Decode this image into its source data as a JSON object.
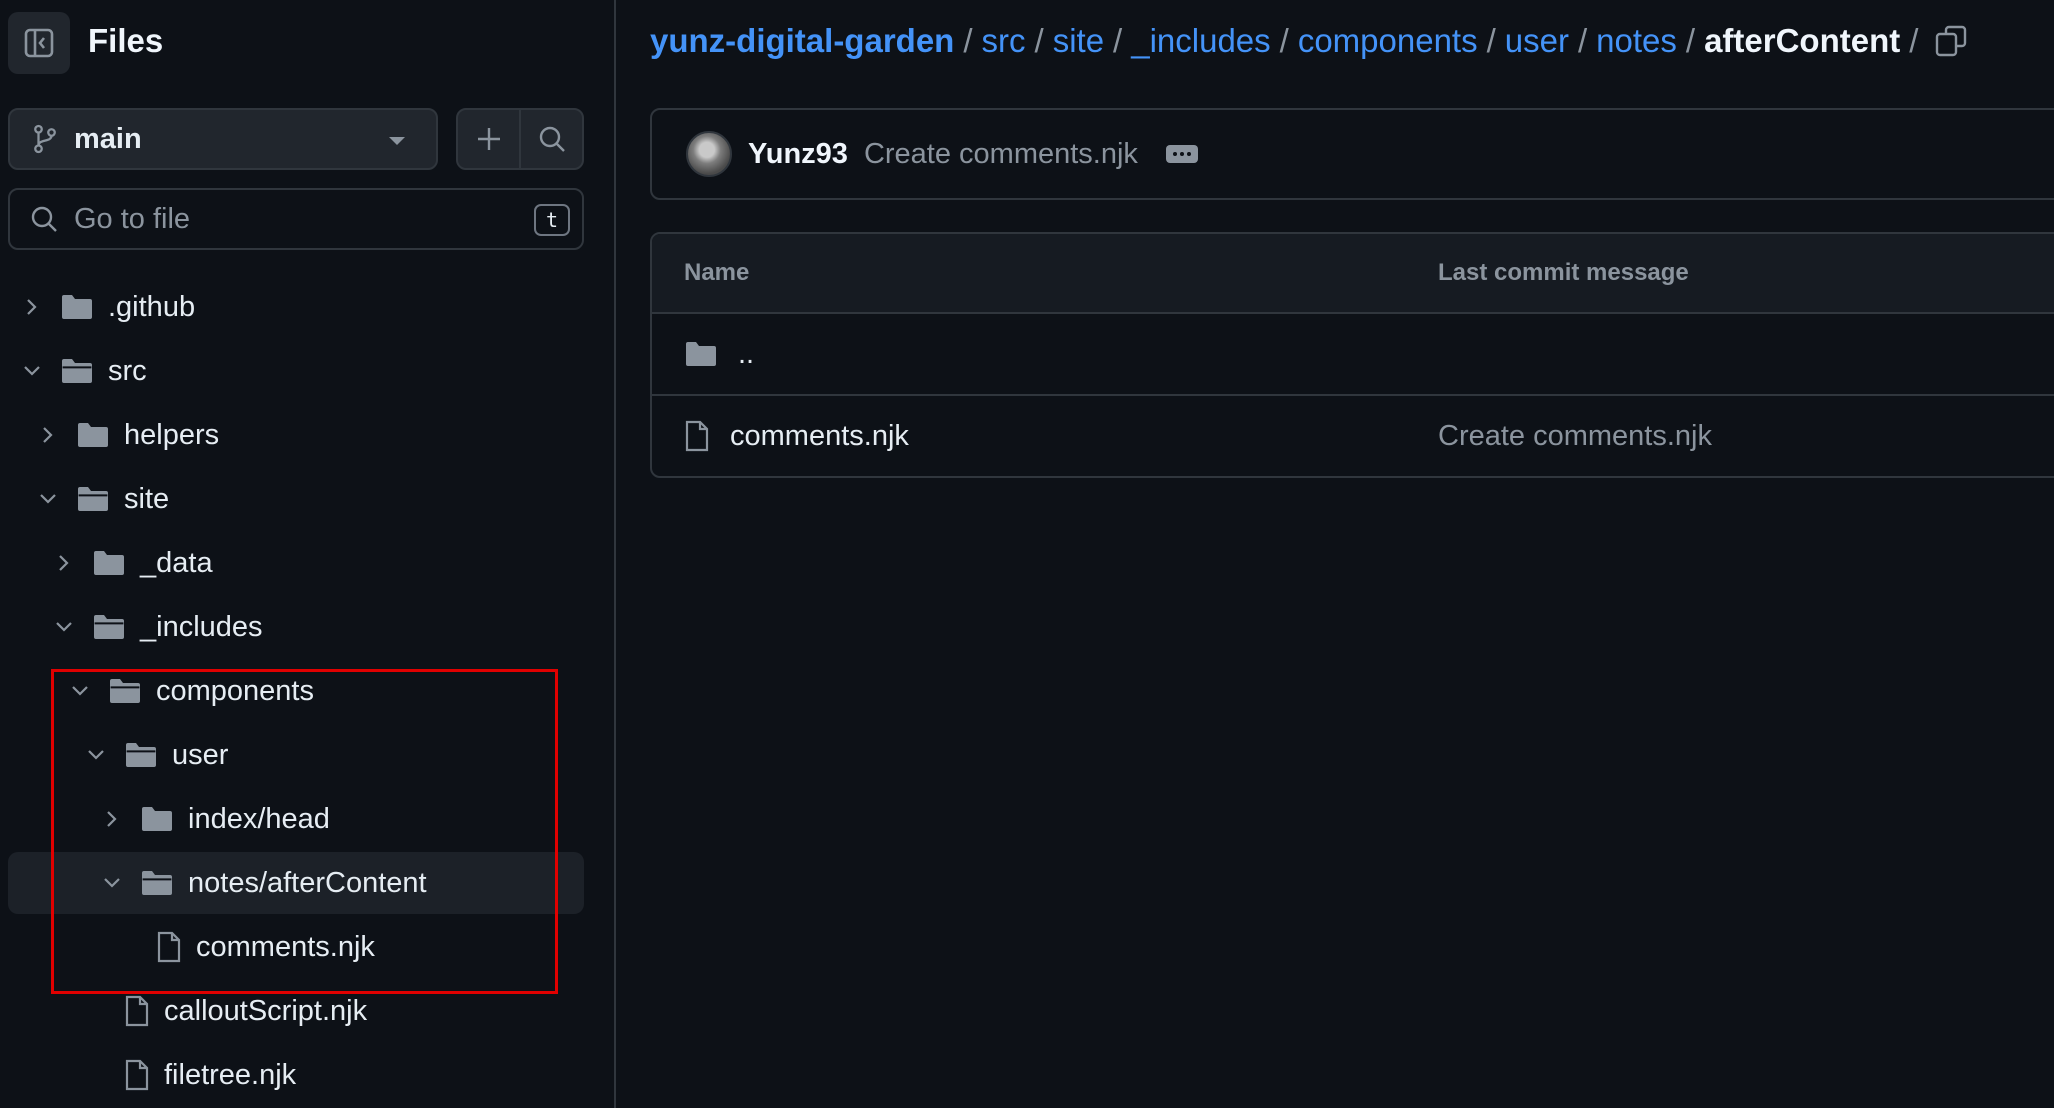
{
  "sidebar": {
    "title": "Files",
    "branch": "main",
    "goto_placeholder": "Go to file",
    "goto_shortcut": "t",
    "tree": [
      {
        "label": ".github",
        "type": "folder",
        "depth": 0,
        "expanded": false
      },
      {
        "label": "src",
        "type": "folder",
        "depth": 0,
        "expanded": true
      },
      {
        "label": "helpers",
        "type": "folder",
        "depth": 1,
        "expanded": false
      },
      {
        "label": "site",
        "type": "folder",
        "depth": 1,
        "expanded": true
      },
      {
        "label": "_data",
        "type": "folder",
        "depth": 2,
        "expanded": false
      },
      {
        "label": "_includes",
        "type": "folder",
        "depth": 2,
        "expanded": true
      },
      {
        "label": "components",
        "type": "folder",
        "depth": 3,
        "expanded": true
      },
      {
        "label": "user",
        "type": "folder",
        "depth": 4,
        "expanded": true
      },
      {
        "label": "index/head",
        "type": "folder",
        "depth": 5,
        "expanded": false
      },
      {
        "label": "notes/afterContent",
        "type": "folder",
        "depth": 5,
        "expanded": true,
        "active": true
      },
      {
        "label": "comments.njk",
        "type": "file",
        "depth": 6
      },
      {
        "label": "calloutScript.njk",
        "type": "file",
        "depth": 4
      },
      {
        "label": "filetree.njk",
        "type": "file",
        "depth": 4
      }
    ]
  },
  "breadcrumb": {
    "repo": "yunz-digital-garden",
    "parts": [
      "src",
      "site",
      "_includes",
      "components",
      "user",
      "notes"
    ],
    "current": "afterContent",
    "trailing": "/"
  },
  "commit": {
    "author": "Yunz93",
    "message": "Create comments.njk"
  },
  "table": {
    "headers": {
      "name": "Name",
      "message": "Last commit message"
    },
    "rows": [
      {
        "name": "..",
        "type": "parent",
        "message": ""
      },
      {
        "name": "comments.njk",
        "type": "file",
        "message": "Create comments.njk"
      }
    ]
  },
  "colors": {
    "background": "#0d1117",
    "link": "#4493f8",
    "border": "#30363d",
    "highlight": "#e00000"
  }
}
